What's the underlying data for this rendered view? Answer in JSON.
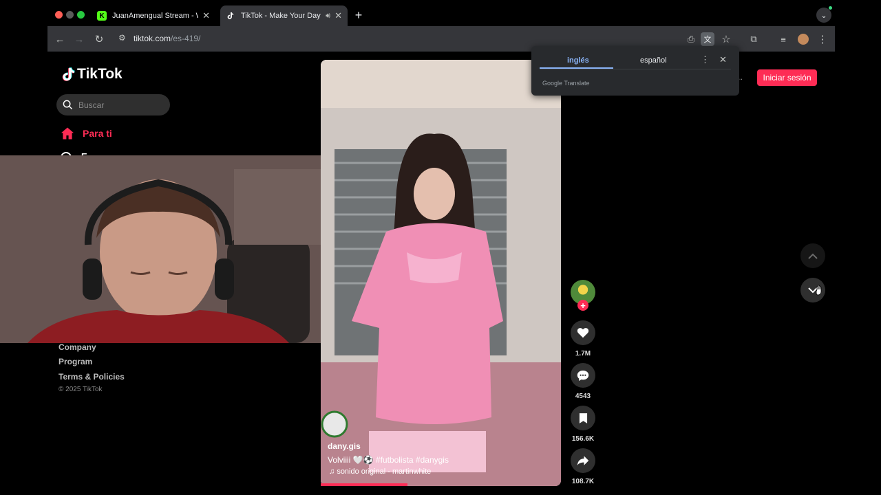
{
  "browser": {
    "tabs": [
      {
        "title": "JuanAmengual Stream - Watc",
        "favicon": "kick-icon"
      },
      {
        "title": "TikTok - Make Your Day",
        "favicon": "tiktok-icon"
      }
    ],
    "new_tab_label": "+",
    "url_host": "tiktok.com",
    "url_path": "/es-419/"
  },
  "sidebar": {
    "logo_text": "TikTok",
    "search_placeholder": "Buscar",
    "nav_for_you": "Para ti",
    "nav_second_partial": "E...",
    "footer_links": [
      "Company",
      "Program",
      "Terms & Policies"
    ],
    "copyright": "© 2025 TikTok"
  },
  "video": {
    "username": "dany.gis",
    "caption": "Volviiii 🤍⚽️ #futbolista  #danygis",
    "sound": "sonido original - martinwhite",
    "progress_fraction": 0.36
  },
  "actions": {
    "likes": "1.7M",
    "comments": "4543",
    "saves": "156.6K",
    "shares": "108.7K",
    "follow_label": "+"
  },
  "header": {
    "login_label": "Iniciar sesión"
  },
  "translate_popup": {
    "source_language": "inglés",
    "target_language": "español",
    "brand": "Google Translate"
  },
  "colors": {
    "tiktok_accent": "#fe2c55",
    "chrome_toolbar": "#35363a",
    "translate_accent": "#8ab4f8"
  }
}
